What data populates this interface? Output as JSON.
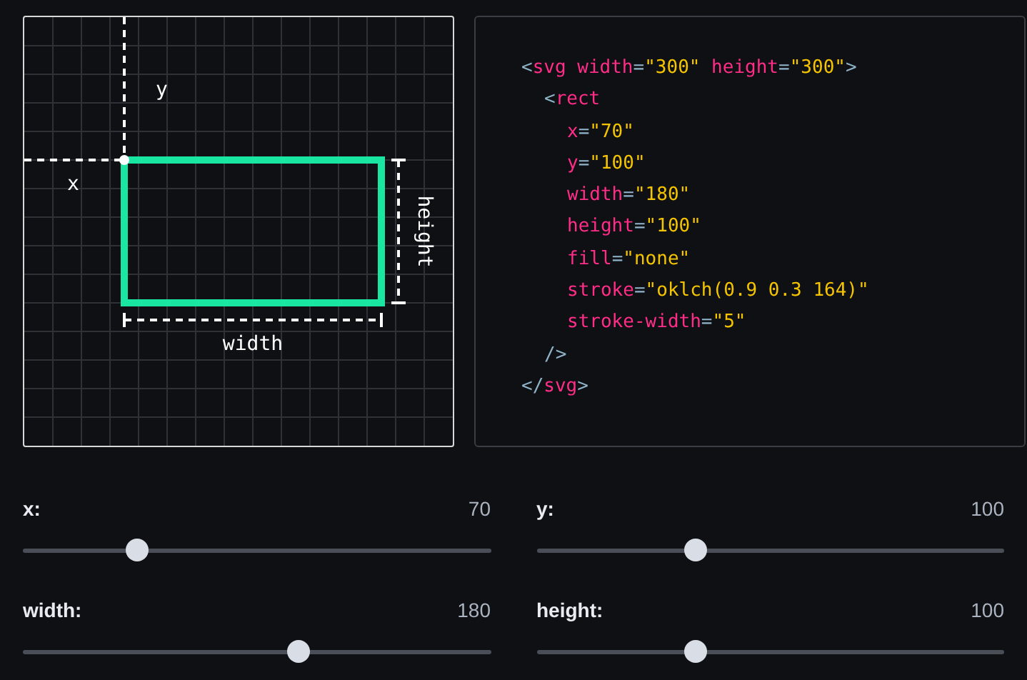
{
  "diagram": {
    "x_label": "x",
    "y_label": "y",
    "width_label": "width",
    "height_label": "height"
  },
  "code": [
    {
      "tokens": [
        {
          "kind": "punct",
          "text": "<"
        },
        {
          "kind": "tag",
          "text": "svg"
        },
        {
          "kind": "attr",
          "text": "width"
        },
        {
          "kind": "punct",
          "text": "="
        },
        {
          "kind": "string",
          "text": "\"300\""
        },
        {
          "kind": "attr",
          "text": "height"
        },
        {
          "kind": "punct",
          "text": "="
        },
        {
          "kind": "string",
          "text": "\"300\""
        },
        {
          "kind": "punct",
          "text": ">"
        }
      ],
      "children": [
        {
          "tokens": [
            {
              "kind": "punct",
              "text": "<"
            },
            {
              "kind": "tag",
              "text": "rect"
            }
          ],
          "children": [
            {
              "tokens": [
                {
                  "kind": "attr",
                  "text": "x"
                },
                {
                  "kind": "punct",
                  "text": "="
                },
                {
                  "kind": "string",
                  "text": "\"70\""
                }
              ]
            },
            {
              "tokens": [
                {
                  "kind": "attr",
                  "text": "y"
                },
                {
                  "kind": "punct",
                  "text": "="
                },
                {
                  "kind": "string",
                  "text": "\"100\""
                }
              ]
            },
            {
              "tokens": [
                {
                  "kind": "attr",
                  "text": "width"
                },
                {
                  "kind": "punct",
                  "text": "="
                },
                {
                  "kind": "string",
                  "text": "\"180\""
                }
              ]
            },
            {
              "tokens": [
                {
                  "kind": "attr",
                  "text": "height"
                },
                {
                  "kind": "punct",
                  "text": "="
                },
                {
                  "kind": "string",
                  "text": "\"100\""
                }
              ]
            },
            {
              "tokens": [
                {
                  "kind": "attr",
                  "text": "fill"
                },
                {
                  "kind": "punct",
                  "text": "="
                },
                {
                  "kind": "string",
                  "text": "\"none\""
                }
              ]
            },
            {
              "tokens": [
                {
                  "kind": "attr",
                  "text": "stroke"
                },
                {
                  "kind": "punct",
                  "text": "="
                },
                {
                  "kind": "string",
                  "text": "\"oklch(0.9 0.3 164)\""
                }
              ]
            },
            {
              "tokens": [
                {
                  "kind": "attr",
                  "text": "stroke-width"
                },
                {
                  "kind": "punct",
                  "text": "="
                },
                {
                  "kind": "string",
                  "text": "\"5\""
                }
              ]
            }
          ]
        },
        {
          "tokens": [
            {
              "kind": "punct",
              "text": "/>"
            }
          ]
        }
      ]
    },
    {
      "tokens": [
        {
          "kind": "punct",
          "text": "</"
        },
        {
          "kind": "tag",
          "text": "svg"
        },
        {
          "kind": "punct",
          "text": ">"
        }
      ]
    }
  ],
  "sliders": [
    {
      "label": "x:",
      "value": "70",
      "level": 0.245
    },
    {
      "label": "y:",
      "value": "100",
      "level": 0.34
    },
    {
      "label": "width:",
      "value": "180",
      "level": 0.59
    },
    {
      "label": "height:",
      "value": "100",
      "level": 0.34
    }
  ]
}
